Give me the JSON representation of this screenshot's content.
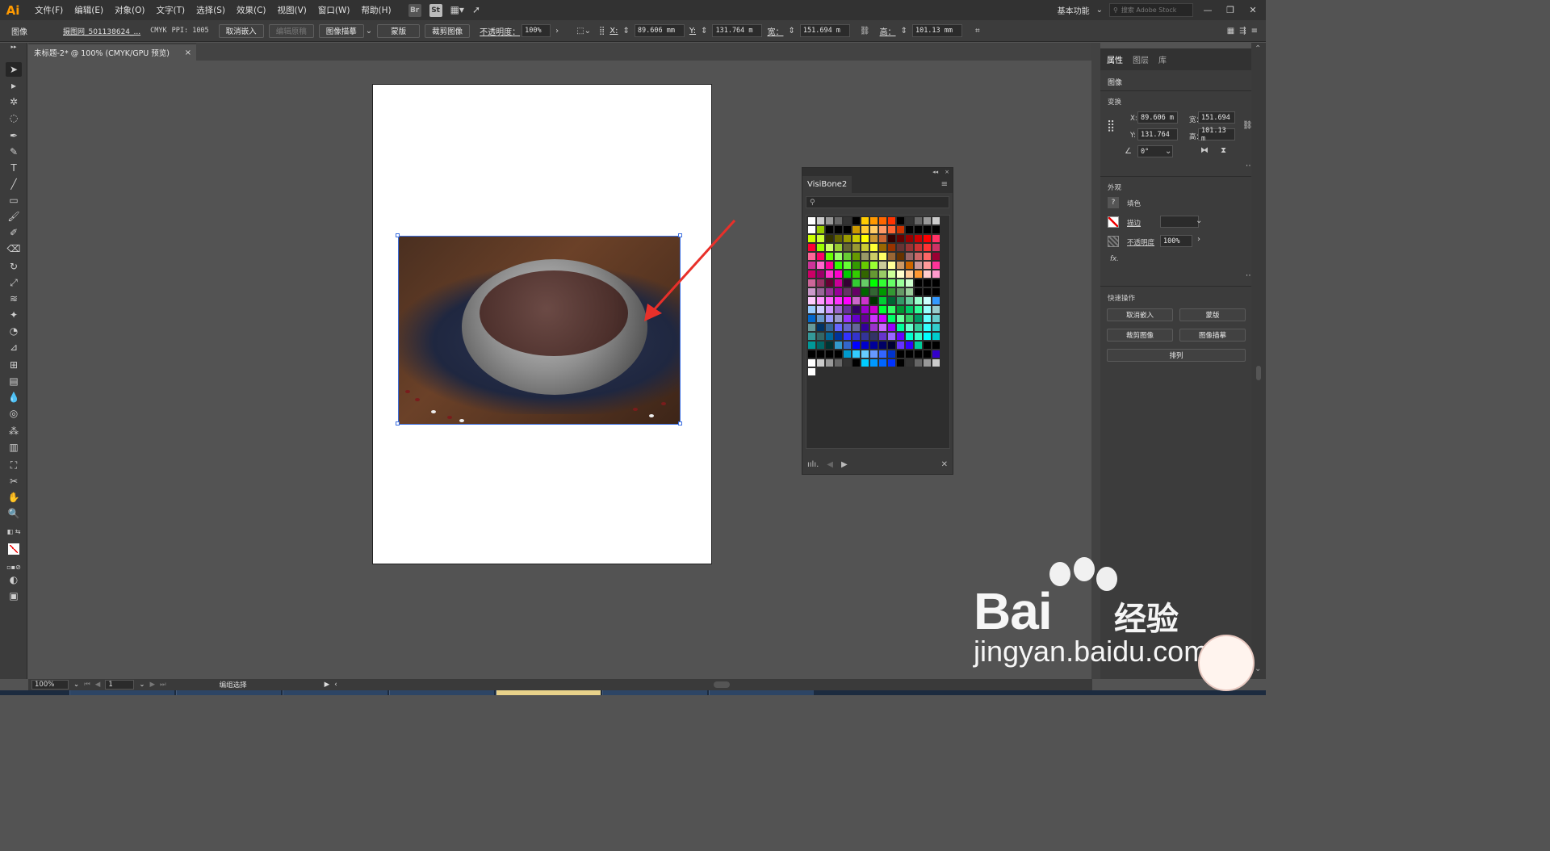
{
  "app": {
    "logo": "Ai"
  },
  "menu": [
    "文件(F)",
    "编辑(E)",
    "对象(O)",
    "文字(T)",
    "选择(S)",
    "效果(C)",
    "视图(V)",
    "窗口(W)",
    "帮助(H)"
  ],
  "bridge": {
    "br": "Br",
    "st": "St"
  },
  "workspace": "基本功能",
  "search_placeholder": "搜索 Adobe Stock",
  "control": {
    "object_type": "图像",
    "filename": "摄图网_501138624_...",
    "color_mode": "CMYK",
    "ppi": "PPI: 1005",
    "unembed": "取消嵌入",
    "edit_original": "编辑原稿",
    "image_trace": "图像描摹",
    "mask": "蒙版",
    "crop": "裁剪图像",
    "opacity_label": "不透明度：",
    "opacity": "100%",
    "x_label": "X:",
    "x": "89.606 mm",
    "y_label": "Y:",
    "y": "131.764 m",
    "w_label": "宽：",
    "w": "151.694 m",
    "h_label": "高：",
    "h": "101.13 mm"
  },
  "doc_tab": {
    "title": "未标题-2* @ 100% (CMYK/GPU 预览)",
    "close": "×"
  },
  "swatches": {
    "tab": "VisiBone2",
    "panel_top": [
      "◂◂",
      "×"
    ]
  },
  "swatch_colors": [
    "#FFFFFF",
    "#CCCCCC",
    "#999999",
    "#666666",
    "#333333",
    "#000000",
    "#FFCC00",
    "#FF9900",
    "#FF6600",
    "#FF3300",
    "#000000",
    "#333333",
    "#666666",
    "#999999",
    "#CCCCCC",
    "#FFFFFF",
    "#99CC00",
    "#000000",
    "#000000",
    "#000000",
    "#CC9900",
    "#FFCC33",
    "#FFCC66",
    "#FF9966",
    "#FF6633",
    "#CC3300",
    "#000000",
    "#000000",
    "#000000",
    "#000000",
    "#CCFF00",
    "#CCFF33",
    "#333300",
    "#666600",
    "#999900",
    "#CCCC00",
    "#FFFF00",
    "#CC9933",
    "#CC6633",
    "#330000",
    "#660000",
    "#990000",
    "#CC0000",
    "#FF0000",
    "#FF3366",
    "#FF0033",
    "#99FF00",
    "#CCFF66",
    "#99CC33",
    "#666633",
    "#999933",
    "#CCCC33",
    "#FFFF33",
    "#996600",
    "#993300",
    "#663333",
    "#993333",
    "#CC3333",
    "#FF3333",
    "#CC3366",
    "#FF6699",
    "#FF0066",
    "#66FF00",
    "#99FF66",
    "#66CC33",
    "#669900",
    "#999966",
    "#CCCC66",
    "#FFFF66",
    "#996633",
    "#663300",
    "#996666",
    "#CC6666",
    "#FF6666",
    "#990033",
    "#CC3399",
    "#FF66CC",
    "#FF0099",
    "#33FF00",
    "#66FF33",
    "#339900",
    "#66CC00",
    "#99FF33",
    "#CCCC99",
    "#FFFF99",
    "#CC9966",
    "#CC6600",
    "#CC9999",
    "#FF9999",
    "#FF3399",
    "#CC0066",
    "#990066",
    "#FF33CC",
    "#FF00CC",
    "#00CC00",
    "#33CC00",
    "#336600",
    "#669933",
    "#99CC66",
    "#CCFF99",
    "#FFFFCC",
    "#FFCC99",
    "#FF9933",
    "#FFCCCC",
    "#FF99CC",
    "#CC6699",
    "#993366",
    "#660033",
    "#CC0099",
    "#330033",
    "#33CC33",
    "#66CC66",
    "#00FF00",
    "#33FF33",
    "#66FF66",
    "#99FF99",
    "#CCFFCC",
    "#000000",
    "#000000",
    "#000000",
    "#CC99CC",
    "#996699",
    "#993399",
    "#990099",
    "#663366",
    "#660066",
    "#006600",
    "#336633",
    "#009900",
    "#339933",
    "#669966",
    "#99CC99",
    "#000000",
    "#000000",
    "#000000",
    "#FFCCFF",
    "#FF99FF",
    "#FF66FF",
    "#FF33FF",
    "#FF00FF",
    "#CC66CC",
    "#CC33CC",
    "#003300",
    "#00CC33",
    "#006633",
    "#339966",
    "#66CC99",
    "#99FFCC",
    "#CCFFFF",
    "#3399FF",
    "#99CCFF",
    "#CCCCFF",
    "#CC99FF",
    "#9966CC",
    "#663399",
    "#330066",
    "#9900CC",
    "#CC00CC",
    "#00FF33",
    "#33FF66",
    "#009933",
    "#00CC66",
    "#33FF99",
    "#99FFFF",
    "#99CCCC",
    "#0066CC",
    "#6699CC",
    "#9999FF",
    "#9999CC",
    "#9933FF",
    "#6600CC",
    "#660099",
    "#CC33FF",
    "#CC00FF",
    "#00FF66",
    "#66FF99",
    "#33CC66",
    "#009966",
    "#66FFFF",
    "#66CCCC",
    "#669999",
    "#003366",
    "#336699",
    "#6666FF",
    "#6666CC",
    "#666699",
    "#330099",
    "#9933CC",
    "#CC66FF",
    "#9900FF",
    "#00FF99",
    "#66FFCC",
    "#33CC99",
    "#33FFFF",
    "#33CCCC",
    "#339999",
    "#336666",
    "#006699",
    "#003399",
    "#3333FF",
    "#3333CC",
    "#333399",
    "#333366",
    "#6633CC",
    "#9966FF",
    "#6600FF",
    "#00FFCC",
    "#33FFCC",
    "#00FFFF",
    "#00CCCC",
    "#009999",
    "#006666",
    "#003333",
    "#3399CC",
    "#3366CC",
    "#0000FF",
    "#0000CC",
    "#000099",
    "#000066",
    "#000033",
    "#6633FF",
    "#3300FF",
    "#00CC99",
    "#000000",
    "#000000",
    "#000000",
    "#000000",
    "#000000",
    "#000000",
    "#0099CC",
    "#33CCFF",
    "#66CCFF",
    "#6699FF",
    "#3366FF",
    "#0033CC",
    "#000000",
    "#000000",
    "#000000",
    "#000000",
    "#3300CC",
    "#FFFFFF",
    "#CCCCCC",
    "#999999",
    "#666666",
    "#333333",
    "#000000",
    "#00CCFF",
    "#0099FF",
    "#0066FF",
    "#0033FF",
    "#000000",
    "#333333",
    "#666666",
    "#999999",
    "#CCCCCC",
    "#FFFFFF"
  ],
  "right_panel": {
    "tabs": [
      "属性",
      "图层",
      "库"
    ],
    "selection": "图像",
    "transform": "变换",
    "x_label": "X:",
    "x": "89.606 m",
    "y_label": "Y:",
    "y": "131.764",
    "w_label": "宽：",
    "w": "151.694",
    "h_label": "高：",
    "h": "101.13 m",
    "angle": "0°",
    "appearance": "外观",
    "fill": "填色",
    "stroke": "描边",
    "opacity_label": "不透明度",
    "opacity": "100%",
    "fx": "fx.",
    "quick_actions": "快速操作",
    "qa_unembed": "取消嵌入",
    "qa_mask": "蒙版",
    "qa_crop": "裁剪图像",
    "qa_trace": "图像描摹",
    "qa_arrange": "排列"
  },
  "status": {
    "zoom": "100%",
    "page": "1",
    "tool": "编组选择"
  },
  "watermark": {
    "brand": "Bai",
    "brand2": "经验",
    "url": "jingyan.baidu.com"
  }
}
